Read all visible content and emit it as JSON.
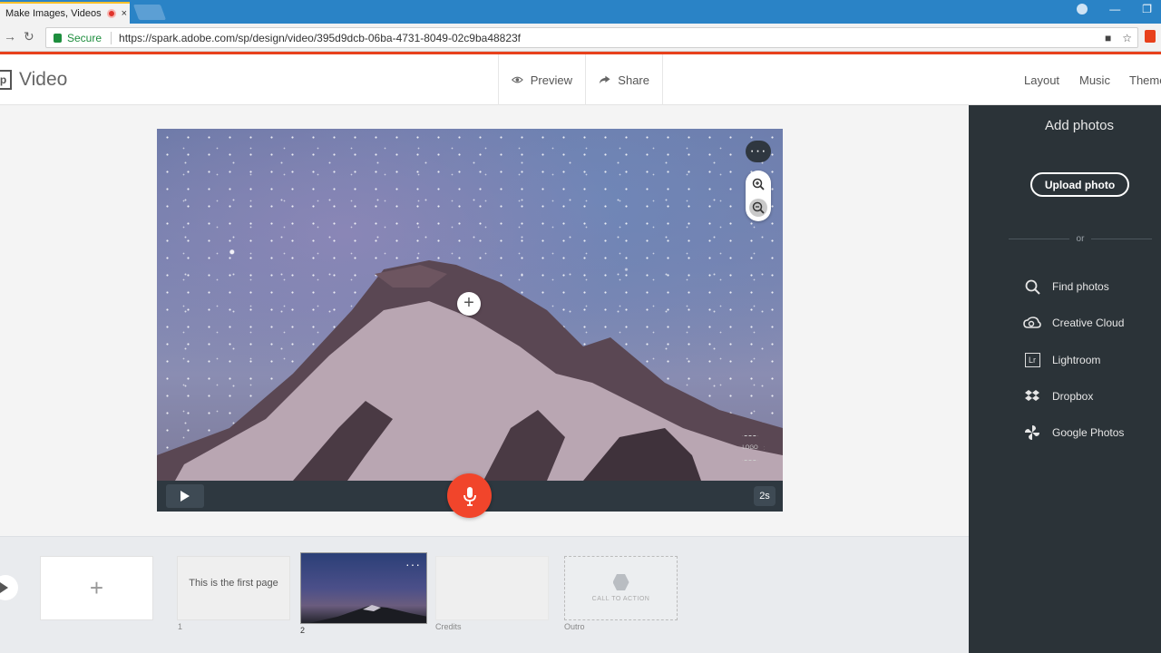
{
  "browser": {
    "tab_title": "Make Images, Videos",
    "tab_close": "×",
    "secure_label": "Secure",
    "url": "https://spark.adobe.com/sp/design/video/395d9dcb-06ba-4731-8049-02c9ba48823f"
  },
  "app": {
    "logo_letter": "p",
    "title": "Video",
    "preview_label": "Preview",
    "share_label": "Share",
    "nav": [
      "Layout",
      "Music",
      "Theme"
    ]
  },
  "stage": {
    "overlay_menu": "···",
    "add_symbol": "+",
    "logo_badge": "LOGO",
    "duration": "2s"
  },
  "timeline": {
    "add_symbol": "+",
    "slides": [
      {
        "number": "1",
        "text": "This is the first page"
      },
      {
        "number": "2",
        "menu": "···"
      },
      {
        "number": "Credits"
      },
      {
        "number": "Outro",
        "text": "CALL TO ACTION"
      }
    ]
  },
  "panel": {
    "title": "Add photos",
    "upload_label": "Upload photo",
    "or_label": "or",
    "sources": [
      {
        "label": "Find photos",
        "icon": "search-icon"
      },
      {
        "label": "Creative Cloud",
        "icon": "creative-cloud-icon"
      },
      {
        "label": "Lightroom",
        "icon": "lightroom-icon"
      },
      {
        "label": "Dropbox",
        "icon": "dropbox-icon"
      },
      {
        "label": "Google Photos",
        "icon": "google-photos-icon"
      }
    ],
    "lightroom_abbrev": "Lr"
  },
  "colors": {
    "accent": "#e8411c",
    "mic": "#f1452b",
    "panel": "#2b3338",
    "browser": "#2a83c6"
  }
}
